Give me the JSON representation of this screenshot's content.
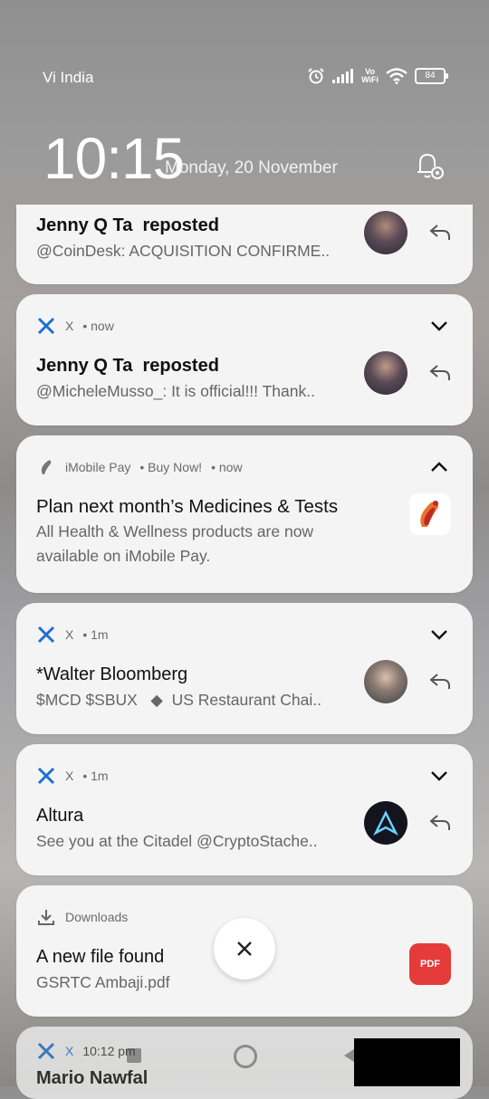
{
  "status": {
    "carrier": "Vi India",
    "vowifi_top": "Vo",
    "vowifi_bottom": "WiFi",
    "battery": "84"
  },
  "lock": {
    "time": "10:15",
    "date": "Monday, 20 November"
  },
  "notifications": [
    {
      "title": "Jenny Q Ta ⁣⁣ reposted",
      "body": "@CoinDesk: ACQUISITION CONFIRME.."
    },
    {
      "app": "X",
      "meta": "• now",
      "title": "Jenny Q Ta ⁣⁣ reposted",
      "body": "@MicheleMusso_: It is official!!! Thank.."
    },
    {
      "app": "iMobile Pay",
      "sub": "• Buy Now!",
      "meta": "• now",
      "title": "Plan next month’s Medicines & Tests",
      "body": "All Health & Wellness products are now available on iMobile Pay."
    },
    {
      "app": "X",
      "meta": "• 1m",
      "title": "*Walter Bloomberg",
      "body": "$MCD $SBUX   ◆  US Restaurant Chai.."
    },
    {
      "app": "X",
      "meta": "• 1m",
      "title": "Altura",
      "body": "See you at the Citadel @CryptoStache.."
    },
    {
      "app": "Downloads",
      "title": "A new file found",
      "body": "GSRTC Ambaji.pdf",
      "badge": "PDF"
    },
    {
      "app": "X",
      "meta": "10:12 pm",
      "title": "Mario Nawfal"
    }
  ],
  "colors": {
    "x_blue": "#1d6fd1",
    "pdf_red": "#e53b3b"
  }
}
